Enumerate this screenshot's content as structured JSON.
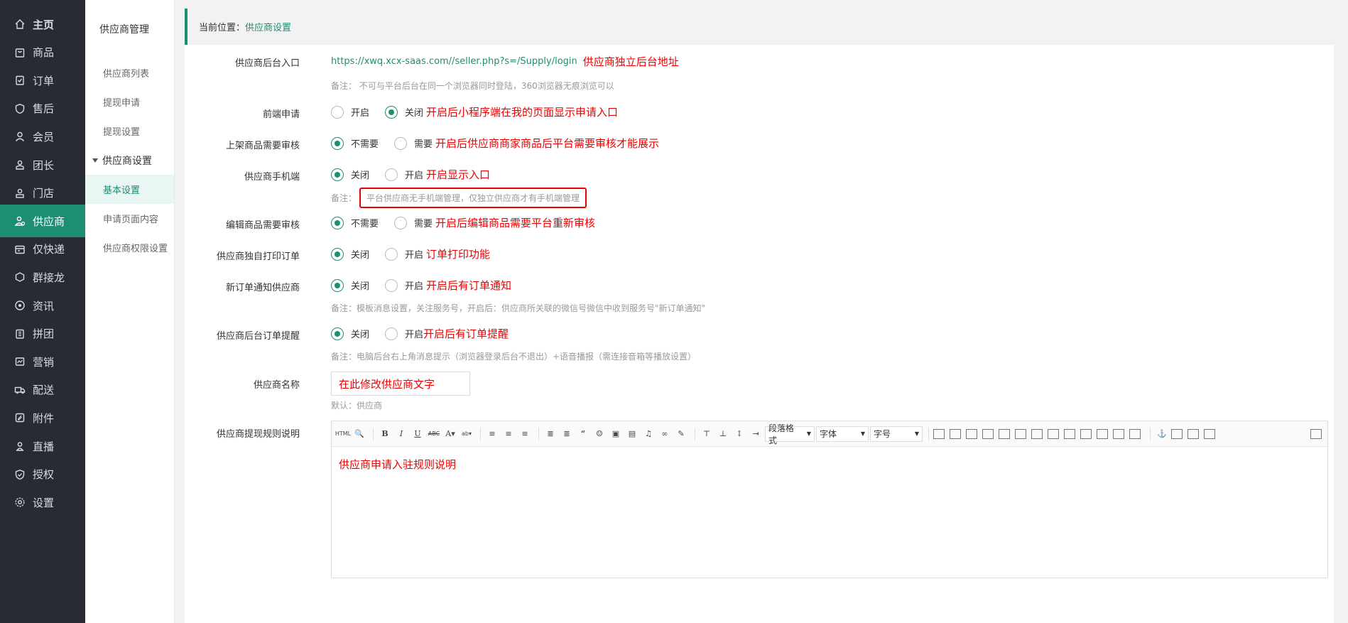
{
  "nav": {
    "items": [
      {
        "label": "主页",
        "icon": "home-icon"
      },
      {
        "label": "商品",
        "icon": "bag-icon"
      },
      {
        "label": "订单",
        "icon": "order-icon"
      },
      {
        "label": "售后",
        "icon": "shield-icon"
      },
      {
        "label": "会员",
        "icon": "user-icon"
      },
      {
        "label": "团长",
        "icon": "leader-icon"
      },
      {
        "label": "门店",
        "icon": "store-icon"
      },
      {
        "label": "供应商",
        "icon": "supplier-icon",
        "active": true
      },
      {
        "label": "仅快递",
        "icon": "delivery-icon"
      },
      {
        "label": "群接龙",
        "icon": "group-icon"
      },
      {
        "label": "资讯",
        "icon": "news-icon"
      },
      {
        "label": "拼团",
        "icon": "group-buy-icon"
      },
      {
        "label": "营销",
        "icon": "marketing-icon"
      },
      {
        "label": "配送",
        "icon": "truck-icon"
      },
      {
        "label": "附件",
        "icon": "attachment-icon"
      },
      {
        "label": "直播",
        "icon": "live-icon"
      },
      {
        "label": "授权",
        "icon": "auth-icon"
      },
      {
        "label": "设置",
        "icon": "gear-icon"
      }
    ]
  },
  "subnav": {
    "title": "供应商管理",
    "items": [
      {
        "label": "供应商列表"
      },
      {
        "label": "提现申请"
      },
      {
        "label": "提现设置"
      }
    ],
    "group": "供应商设置",
    "group_items": [
      {
        "label": "基本设置",
        "active": true
      },
      {
        "label": "申请页面内容"
      },
      {
        "label": "供应商权限设置"
      }
    ]
  },
  "breadcrumb": {
    "prefix": "当前位置：",
    "current": "供应商设置"
  },
  "form": {
    "backend_entry": {
      "label": "供应商后台入口",
      "url": "https://xwq.xcx-saas.com//seller.php?s=/Supply/login",
      "annotation": "供应商独立后台地址",
      "note": "备注：  不可与平台后台在同一个浏览器同时登陆，360浏览器无痕浏览可以"
    },
    "front_apply": {
      "label": "前端申请",
      "opt_on": "开启",
      "opt_off": "关闭",
      "annotation": "开启后小程序端在我的页面显示申请入口"
    },
    "listing_review": {
      "label": "上架商品需要审核",
      "opt_a": "不需要",
      "opt_b": "需要",
      "annotation": "开启后供应商商家商品后平台需要审核才能展示"
    },
    "mobile": {
      "label": "供应商手机端",
      "opt_off": "关闭",
      "opt_on": "开启",
      "annotation": "开启显示入口",
      "note_prefix": "备注：",
      "note": "平台供应商无手机端管理，仅独立供应商才有手机端管理"
    },
    "edit_review": {
      "label": "编辑商品需要审核",
      "opt_a": "不需要",
      "opt_b": "需要",
      "annotation": "开启后编辑商品需要平台重新审核"
    },
    "print": {
      "label": "供应商独自打印订单",
      "opt_off": "关闭",
      "opt_on": "开启",
      "annotation": "订单打印功能"
    },
    "order_notify": {
      "label": "新订单通知供应商",
      "opt_off": "关闭",
      "opt_on": "开启",
      "annotation": "开启后有订单通知",
      "note": "备注：模板消息设置，关注服务号，开启后：供应商所关联的微信号微信中收到服务号\"新订单通知\""
    },
    "order_remind": {
      "label": "供应商后台订单提醒",
      "opt_off": "关闭",
      "opt_on": "开启",
      "annotation": "开启后有订单提醒",
      "note": "备注：电脑后台右上角消息提示（浏览器登录后台不退出）+语音播报（需连接音箱等播放设置）"
    },
    "name": {
      "label": "供应商名称",
      "value": "在此修改供应商文字",
      "default_note": "默认：供应商"
    },
    "rules": {
      "label": "供应商提现规则说明",
      "editor": {
        "select_para": "段落格式",
        "select_font": "字体",
        "select_size": "字号",
        "content": "供应商申请入驻规则说明"
      }
    }
  },
  "colors": {
    "accent": "#1e8e73",
    "nav_bg": "#282b33",
    "annotation_red": "#ee0000"
  }
}
